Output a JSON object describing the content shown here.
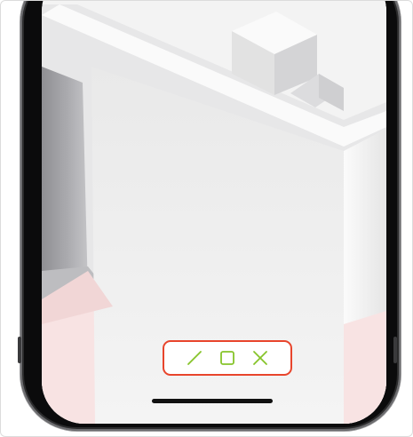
{
  "toolbar": {
    "tools": [
      {
        "name": "line-tool",
        "icon": "line-icon"
      },
      {
        "name": "rectangle-tool",
        "icon": "square-icon"
      },
      {
        "name": "close-tool",
        "icon": "close-icon"
      }
    ],
    "icon_color": "#86c42a",
    "border_color": "#e8452c"
  },
  "colors": {
    "phone_frame": "#2b2b2c",
    "floor": "#f8e3e3",
    "wall": "#f0f0f0"
  }
}
